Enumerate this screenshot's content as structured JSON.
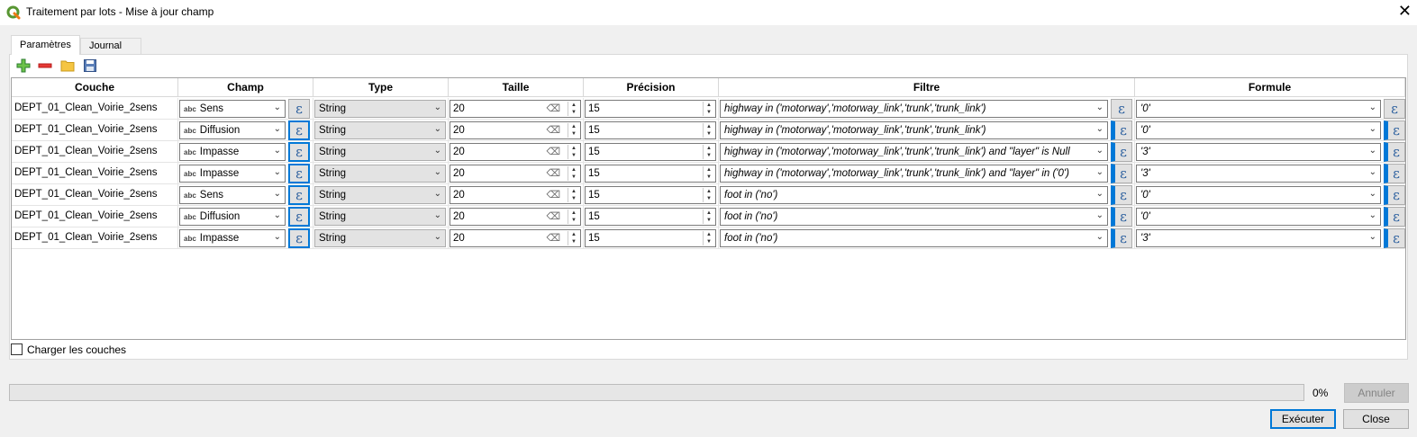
{
  "window": {
    "title": "Traitement par lots - Mise à jour champ",
    "close_glyph": "✕"
  },
  "tabs": [
    {
      "label": "Paramètres",
      "active": true
    },
    {
      "label": "Journal",
      "active": false
    }
  ],
  "toolbar": {
    "icons": [
      "add-row-icon",
      "remove-row-icon",
      "open-folder-icon",
      "save-icon"
    ]
  },
  "table": {
    "headers": [
      "Couche",
      "Champ",
      "Type",
      "Taille",
      "Précision",
      "Filtre",
      "Formule"
    ],
    "rows": [
      {
        "couche": "DEPT_01_Clean_Voirie_2sens",
        "champ": "Sens",
        "type": "String",
        "taille": "20",
        "precision": "15",
        "filtre": "highway in ('motorway','motorway_link','trunk','trunk_link')",
        "formule": "'0'"
      },
      {
        "couche": "DEPT_01_Clean_Voirie_2sens",
        "champ": "Diffusion",
        "type": "String",
        "taille": "20",
        "precision": "15",
        "filtre": "highway in ('motorway','motorway_link','trunk','trunk_link')",
        "formule": "'0'"
      },
      {
        "couche": "DEPT_01_Clean_Voirie_2sens",
        "champ": "Impasse",
        "type": "String",
        "taille": "20",
        "precision": "15",
        "filtre": "highway in ('motorway','motorway_link','trunk','trunk_link') and \"layer\" is Null",
        "formule": "'3'"
      },
      {
        "couche": "DEPT_01_Clean_Voirie_2sens",
        "champ": "Impasse",
        "type": "String",
        "taille": "20",
        "precision": "15",
        "filtre": "highway in ('motorway','motorway_link','trunk','trunk_link') and \"layer\" in ('0')",
        "formule": "'3'"
      },
      {
        "couche": "DEPT_01_Clean_Voirie_2sens",
        "champ": "Sens",
        "type": "String",
        "taille": "20",
        "precision": "15",
        "filtre": "foot in ('no')",
        "formule": "'0'"
      },
      {
        "couche": "DEPT_01_Clean_Voirie_2sens",
        "champ": "Diffusion",
        "type": "String",
        "taille": "20",
        "precision": "15",
        "filtre": "foot in ('no')",
        "formule": "'0'"
      },
      {
        "couche": "DEPT_01_Clean_Voirie_2sens",
        "champ": "Impasse",
        "type": "String",
        "taille": "20",
        "precision": "15",
        "filtre": "foot in ('no')",
        "formule": "'3'"
      }
    ],
    "field_type_badge": "abc",
    "expression_glyph": "ε"
  },
  "options": {
    "load_layers_label": "Charger les couches",
    "load_layers_checked": false
  },
  "footer": {
    "progress_fraction": 0.0,
    "progress_text": "0%",
    "cancel_label": "Annuler",
    "run_label": "Exécuter",
    "close_label": "Close"
  },
  "colors": {
    "focus_blue": "#0078d7",
    "expression_icon": "#2b5f9e",
    "progress_green": "#06b025"
  }
}
